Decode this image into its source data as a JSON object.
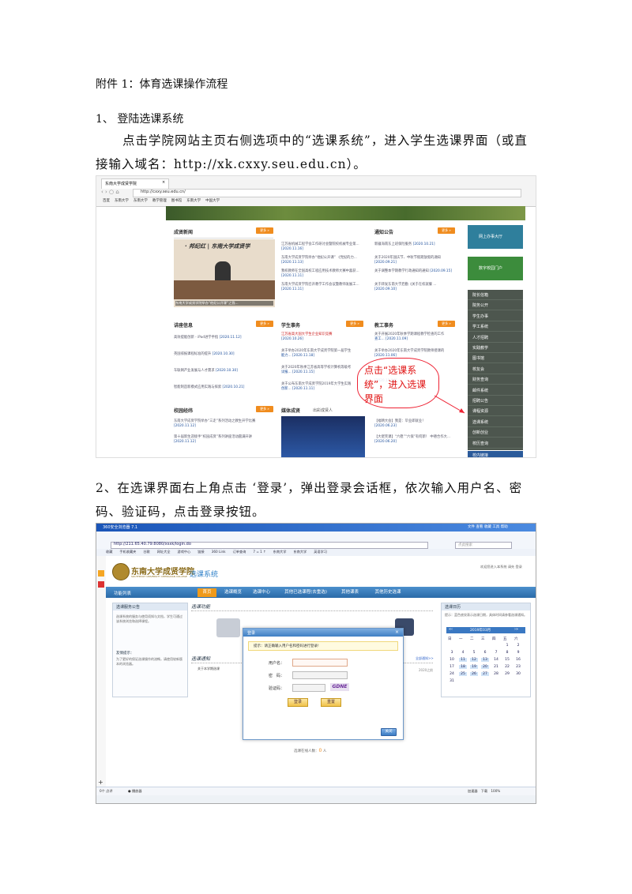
{
  "doc": {
    "heading": "附件 1：体育选课操作流程",
    "step1_title": "1、 登陆选课系统",
    "step1_body": "点击学院网站主页右侧选项中的“选课系统”，进入学生选课界面（或直接输入域名：http://xk.cxxy.seu.edu.cn）。",
    "step2_body": "2、在选课界面右上角点击 ‘登录’，弹出登录会话框，依次输入用户名、密码、验证码，点击登录按钮。"
  },
  "shot1": {
    "tab_title": "东南大学成贤学院",
    "url": "http://cxxy.seu.edu.cn/",
    "bookmarks": [
      "百度",
      "东南大学",
      "东南大学",
      "教学管理",
      "图书馆",
      "东南大学",
      "中国大学"
    ],
    "banner_quote": "· 邦纪红 | 东南大学成贤学",
    "photo_caption": "东南大学成贤学院举办“他纪公开课”之我...",
    "sections": {
      "news": "成贤新闻",
      "notice": "通知公告",
      "lecture": "讲座信息",
      "student": "学生事务",
      "teaching": "教工事务",
      "campus": "校园经纬",
      "media": "媒体成贤",
      "media_sub": "出彩成贤人"
    },
    "more": "更多 »",
    "news_items": [
      {
        "t": "江苏省机械工程学会工作研讨会暨院校机械专业第...",
        "d": "[2020.11.16]"
      },
      {
        "t": "东南大学成贤学院举办“他纪公开课” 《党纪的力...",
        "d": "[2020.11.13]"
      },
      {
        "t": "我校教师在全国高校工程应用技术教师大赛中喜获...",
        "d": "[2020.11.11]"
      },
      {
        "t": "东南大学成贤学院召开教学工作会议暨教师发展工...",
        "d": "[2020.11.11]"
      }
    ],
    "notice_items": [
      {
        "t": "新疆海南东上班保险服务",
        "d": "[2020.10.21]"
      },
      {
        "t": "关于2020年国庆节、中秋节假期放假的通知",
        "d": "[2020.09.21]"
      },
      {
        "t": "关于调整本学期教学行政通知的通知",
        "d": "[2020.09.15]"
      },
      {
        "t": "关于转发东南大学后勤《关于在校就餐 ...",
        "d": "[2020.09.10]"
      }
    ],
    "lecture_items": [
      {
        "t": "高效提能创新 - iPad进学手指",
        "d": "[2020.11.12]"
      },
      {
        "t": "英国排报课程标准的提升",
        "d": "[2020.10.30]"
      },
      {
        "t": "车联网产业发展与人才需求",
        "d": "[2020.10.30]"
      },
      {
        "t": "智能制造新模式应用实践与探索",
        "d": "[2020.10.21]"
      }
    ],
    "student_items": [
      {
        "t": "江苏省高大国大学生企业知识竞赛",
        "d": "[2020.10.26]"
      },
      {
        "t": "关于举办2020年东南大学成贤学院第一届学生",
        "d": "能力... [2020.11.18]"
      },
      {
        "t": "关于2020年秋季江苏省高等学校计算机等级考",
        "d": "试报... [2020.11.15]"
      },
      {
        "t": "关于公布东南大学成贤学院2019年大学生实践",
        "d": "创新... [2020.11.11]"
      }
    ],
    "teaching_items": [
      {
        "t": "关于开展2020年秋季学期课程教学检查的工作",
        "d": "查工... [2020.11.09]"
      },
      {
        "t": "关于举办2020年东南大学成贤学院教师授课的",
        "d": "[2020.11.06]"
      },
      {
        "t": "",
        "d": "[2020.11.04]"
      }
    ],
    "campus_items": [
      {
        "t": "东南大学成贤学院举办“三走”系列活动之教生开学比赛",
        "d": "[2020.11.12]"
      },
      {
        "t": "第十届新生迎接手“校园成贤”系列讲座活动圆满开讲",
        "d": "[2020.11.12]"
      }
    ],
    "media_items": [
      {
        "t": "【福晴大会】我是：毕业即就业！",
        "d": "[2020.06.23]"
      },
      {
        "t": "【大佬笑课】“六稳”“六保”有何新！ 中德合作大...",
        "d": "[2020.06.20]"
      }
    ],
    "side_big": [
      "网上办事大厅",
      "数字校园门户"
    ],
    "side_items": [
      "院长信箱",
      "院务公开",
      "学生办事",
      "学工系统",
      "人才招聘",
      "实践教学",
      "图书馆",
      "校友会",
      "财务查询",
      "邮件系统",
      "招聘公告",
      "课程资源",
      "选课系统",
      "创新创业",
      "校历查询"
    ],
    "side_bottom": "校内链接",
    "callout": "点击“选课系统”，进入选课界面"
  },
  "shot2": {
    "window_title": "360安全浏览器 7.1",
    "url": "http://211.65.40.79:8080/xsxk/login.do",
    "search_placeholder": "点此搜索",
    "menu": [
      "文件",
      "查看",
      "收藏",
      "工具",
      "帮助"
    ],
    "bookmarks": [
      "收藏",
      "手机收藏夹",
      "谷歌",
      "网址大全",
      "游戏中心",
      "链接",
      "360 Link",
      "订单查询",
      "7 = 1 ↑",
      "东南大学",
      "东南大学",
      "英语学习"
    ],
    "school_name": "东南大学成贤学院",
    "school_en": "SOUTHEAST UNIVERSITY CHENGXIAN COLLEGE",
    "system_name": "选课系统",
    "top_right": "欢迎您进入本系统  请先 登录",
    "nav_left": "功能列表",
    "tabs": [
      "首页",
      "选课概览",
      "选课中心",
      "其他已选课程(去重选)",
      "其他课表",
      "其他历史选课"
    ],
    "left_panel_title": "选课服务公告",
    "left_panel_text": "选课系统的服务与使用须知与文档，学生可通过该系统浏览和选择课程。",
    "left_notice_title": "友情提示：",
    "left_notice_text": "为了更好的保证选课操作的流畅，请使用较新版本的浏览器。",
    "func_heading": "选课功能",
    "notice_heading": "选课通知",
    "notice_item": "关于本学期选课",
    "notice_link": "全部通知>>",
    "notice_date": "2020之前",
    "calendar_title": "选课日历",
    "calendar_note": "提示：蓝色底纹表示选课日期，具体时间请参看选课通知。",
    "calendar_month": "2019年03月",
    "calendar_head": [
      "日",
      "一",
      "二",
      "三",
      "四",
      "五",
      "六"
    ],
    "calendar_rows": [
      [
        "",
        "",
        "",
        "",
        "",
        "1",
        "2"
      ],
      [
        "3",
        "4",
        "5",
        "6",
        "7",
        "8",
        "9"
      ],
      [
        "10",
        "11",
        "12",
        "13",
        "14",
        "15",
        "16"
      ],
      [
        "17",
        "18",
        "19",
        "20",
        "21",
        "22",
        "23"
      ],
      [
        "24",
        "25",
        "26",
        "27",
        "28",
        "29",
        "30"
      ],
      [
        "31",
        "",
        "",
        "",
        "",
        "",
        ""
      ]
    ],
    "dialog": {
      "title": "登录",
      "prompt": "提示：请正确输入用户名和密码进行登录!",
      "user_label": "用户名：",
      "pass_label": "密　码：",
      "captcha_label": "验证码：",
      "captcha_text": "GDNE",
      "login": "登录",
      "reset": "重置",
      "close": "关闭"
    },
    "online": "选课在线人数：",
    "online_count": "0",
    "online_unit": "人",
    "status_left": "0个 点评",
    "status_2": "● 播放器 ",
    "status_right": [
      "加速器",
      "下载",
      "100%"
    ]
  }
}
